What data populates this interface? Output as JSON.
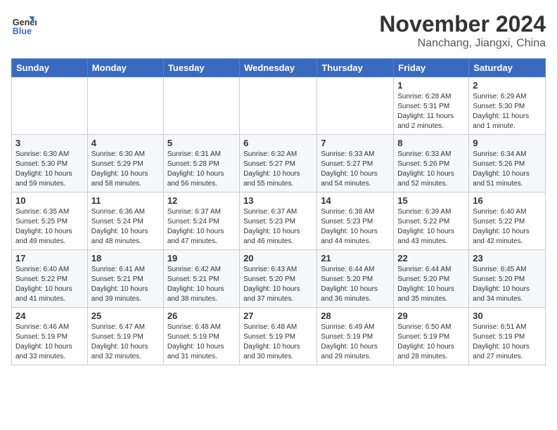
{
  "header": {
    "logo_line1": "General",
    "logo_line2": "Blue",
    "month_title": "November 2024",
    "location": "Nanchang, Jiangxi, China"
  },
  "days_of_week": [
    "Sunday",
    "Monday",
    "Tuesday",
    "Wednesday",
    "Thursday",
    "Friday",
    "Saturday"
  ],
  "weeks": [
    [
      {
        "day": "",
        "info": ""
      },
      {
        "day": "",
        "info": ""
      },
      {
        "day": "",
        "info": ""
      },
      {
        "day": "",
        "info": ""
      },
      {
        "day": "",
        "info": ""
      },
      {
        "day": "1",
        "info": "Sunrise: 6:28 AM\nSunset: 5:31 PM\nDaylight: 11 hours and 2 minutes."
      },
      {
        "day": "2",
        "info": "Sunrise: 6:29 AM\nSunset: 5:30 PM\nDaylight: 11 hours and 1 minute."
      }
    ],
    [
      {
        "day": "3",
        "info": "Sunrise: 6:30 AM\nSunset: 5:30 PM\nDaylight: 10 hours and 59 minutes."
      },
      {
        "day": "4",
        "info": "Sunrise: 6:30 AM\nSunset: 5:29 PM\nDaylight: 10 hours and 58 minutes."
      },
      {
        "day": "5",
        "info": "Sunrise: 6:31 AM\nSunset: 5:28 PM\nDaylight: 10 hours and 56 minutes."
      },
      {
        "day": "6",
        "info": "Sunrise: 6:32 AM\nSunset: 5:27 PM\nDaylight: 10 hours and 55 minutes."
      },
      {
        "day": "7",
        "info": "Sunrise: 6:33 AM\nSunset: 5:27 PM\nDaylight: 10 hours and 54 minutes."
      },
      {
        "day": "8",
        "info": "Sunrise: 6:33 AM\nSunset: 5:26 PM\nDaylight: 10 hours and 52 minutes."
      },
      {
        "day": "9",
        "info": "Sunrise: 6:34 AM\nSunset: 5:26 PM\nDaylight: 10 hours and 51 minutes."
      }
    ],
    [
      {
        "day": "10",
        "info": "Sunrise: 6:35 AM\nSunset: 5:25 PM\nDaylight: 10 hours and 49 minutes."
      },
      {
        "day": "11",
        "info": "Sunrise: 6:36 AM\nSunset: 5:24 PM\nDaylight: 10 hours and 48 minutes."
      },
      {
        "day": "12",
        "info": "Sunrise: 6:37 AM\nSunset: 5:24 PM\nDaylight: 10 hours and 47 minutes."
      },
      {
        "day": "13",
        "info": "Sunrise: 6:37 AM\nSunset: 5:23 PM\nDaylight: 10 hours and 46 minutes."
      },
      {
        "day": "14",
        "info": "Sunrise: 6:38 AM\nSunset: 5:23 PM\nDaylight: 10 hours and 44 minutes."
      },
      {
        "day": "15",
        "info": "Sunrise: 6:39 AM\nSunset: 5:22 PM\nDaylight: 10 hours and 43 minutes."
      },
      {
        "day": "16",
        "info": "Sunrise: 6:40 AM\nSunset: 5:22 PM\nDaylight: 10 hours and 42 minutes."
      }
    ],
    [
      {
        "day": "17",
        "info": "Sunrise: 6:40 AM\nSunset: 5:22 PM\nDaylight: 10 hours and 41 minutes."
      },
      {
        "day": "18",
        "info": "Sunrise: 6:41 AM\nSunset: 5:21 PM\nDaylight: 10 hours and 39 minutes."
      },
      {
        "day": "19",
        "info": "Sunrise: 6:42 AM\nSunset: 5:21 PM\nDaylight: 10 hours and 38 minutes."
      },
      {
        "day": "20",
        "info": "Sunrise: 6:43 AM\nSunset: 5:20 PM\nDaylight: 10 hours and 37 minutes."
      },
      {
        "day": "21",
        "info": "Sunrise: 6:44 AM\nSunset: 5:20 PM\nDaylight: 10 hours and 36 minutes."
      },
      {
        "day": "22",
        "info": "Sunrise: 6:44 AM\nSunset: 5:20 PM\nDaylight: 10 hours and 35 minutes."
      },
      {
        "day": "23",
        "info": "Sunrise: 6:45 AM\nSunset: 5:20 PM\nDaylight: 10 hours and 34 minutes."
      }
    ],
    [
      {
        "day": "24",
        "info": "Sunrise: 6:46 AM\nSunset: 5:19 PM\nDaylight: 10 hours and 33 minutes."
      },
      {
        "day": "25",
        "info": "Sunrise: 6:47 AM\nSunset: 5:19 PM\nDaylight: 10 hours and 32 minutes."
      },
      {
        "day": "26",
        "info": "Sunrise: 6:48 AM\nSunset: 5:19 PM\nDaylight: 10 hours and 31 minutes."
      },
      {
        "day": "27",
        "info": "Sunrise: 6:48 AM\nSunset: 5:19 PM\nDaylight: 10 hours and 30 minutes."
      },
      {
        "day": "28",
        "info": "Sunrise: 6:49 AM\nSunset: 5:19 PM\nDaylight: 10 hours and 29 minutes."
      },
      {
        "day": "29",
        "info": "Sunrise: 6:50 AM\nSunset: 5:19 PM\nDaylight: 10 hours and 28 minutes."
      },
      {
        "day": "30",
        "info": "Sunrise: 6:51 AM\nSunset: 5:19 PM\nDaylight: 10 hours and 27 minutes."
      }
    ]
  ]
}
